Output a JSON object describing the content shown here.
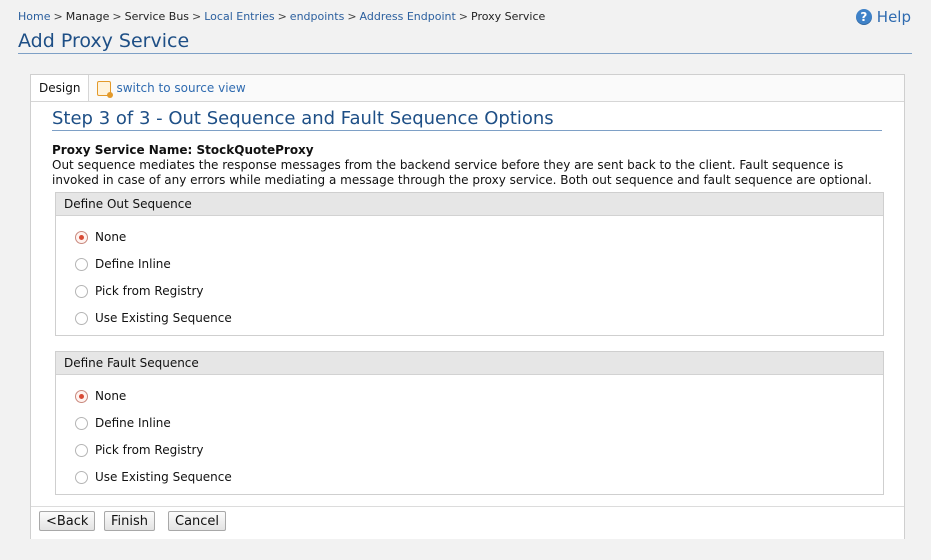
{
  "breadcrumb": {
    "items": [
      "Home",
      "Manage",
      "Service Bus",
      "Local Entries",
      "endpoints",
      "Address Endpoint",
      "Proxy Service"
    ],
    "separator": ">"
  },
  "help": {
    "label": "Help",
    "glyph": "?"
  },
  "page_title": "Add Proxy Service",
  "tabs": {
    "design": "Design",
    "source": "switch to source view"
  },
  "step_title": "Step 3 of 3 - Out Sequence and Fault Sequence Options",
  "proxy_name": "Proxy Service Name: StockQuoteProxy",
  "description": "Out sequence mediates the response messages from the backend service before they are sent back to the client. Fault sequence is invoked in case of any errors while mediating a message through the proxy service. Both out sequence and fault sequence are optional.",
  "out_sequence": {
    "header": "Define Out Sequence",
    "options": [
      "None",
      "Define Inline",
      "Pick from Registry",
      "Use Existing Sequence"
    ],
    "selected": "None"
  },
  "fault_sequence": {
    "header": "Define Fault Sequence",
    "options": [
      "None",
      "Define Inline",
      "Pick from Registry",
      "Use Existing Sequence"
    ],
    "selected": "None"
  },
  "buttons": {
    "back": "<Back",
    "finish": "Finish",
    "cancel": "Cancel"
  },
  "colors": {
    "accent": "#1e4f86",
    "link": "#2f6bb0",
    "radio_selected": "#d84b35"
  }
}
